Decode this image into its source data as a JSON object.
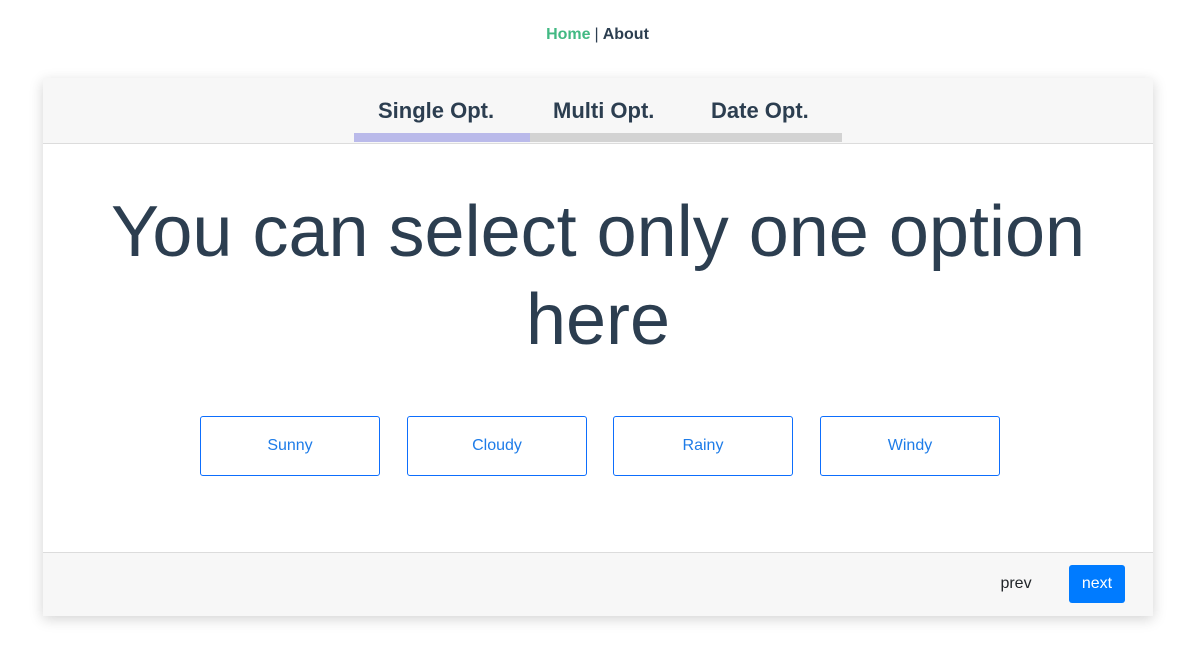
{
  "nav": {
    "home_label": "Home",
    "separator": "|",
    "about_label": "About"
  },
  "tabs": [
    {
      "label": "Single Opt."
    },
    {
      "label": "Multi Opt."
    },
    {
      "label": "Date Opt."
    }
  ],
  "progress": {
    "completed_fraction": 0.36
  },
  "question": {
    "text": "You can select only one option here"
  },
  "options": [
    {
      "label": "Sunny"
    },
    {
      "label": "Cloudy"
    },
    {
      "label": "Rainy"
    },
    {
      "label": "Windy"
    }
  ],
  "footer": {
    "prev_label": "prev",
    "next_label": "next"
  },
  "colors": {
    "nav_active": "#42b983",
    "text": "#2c3e50",
    "progress_fill": "#babaea",
    "progress_track": "#d3d3d3",
    "option_border": "#0d6efd",
    "primary_button": "#007bff"
  }
}
